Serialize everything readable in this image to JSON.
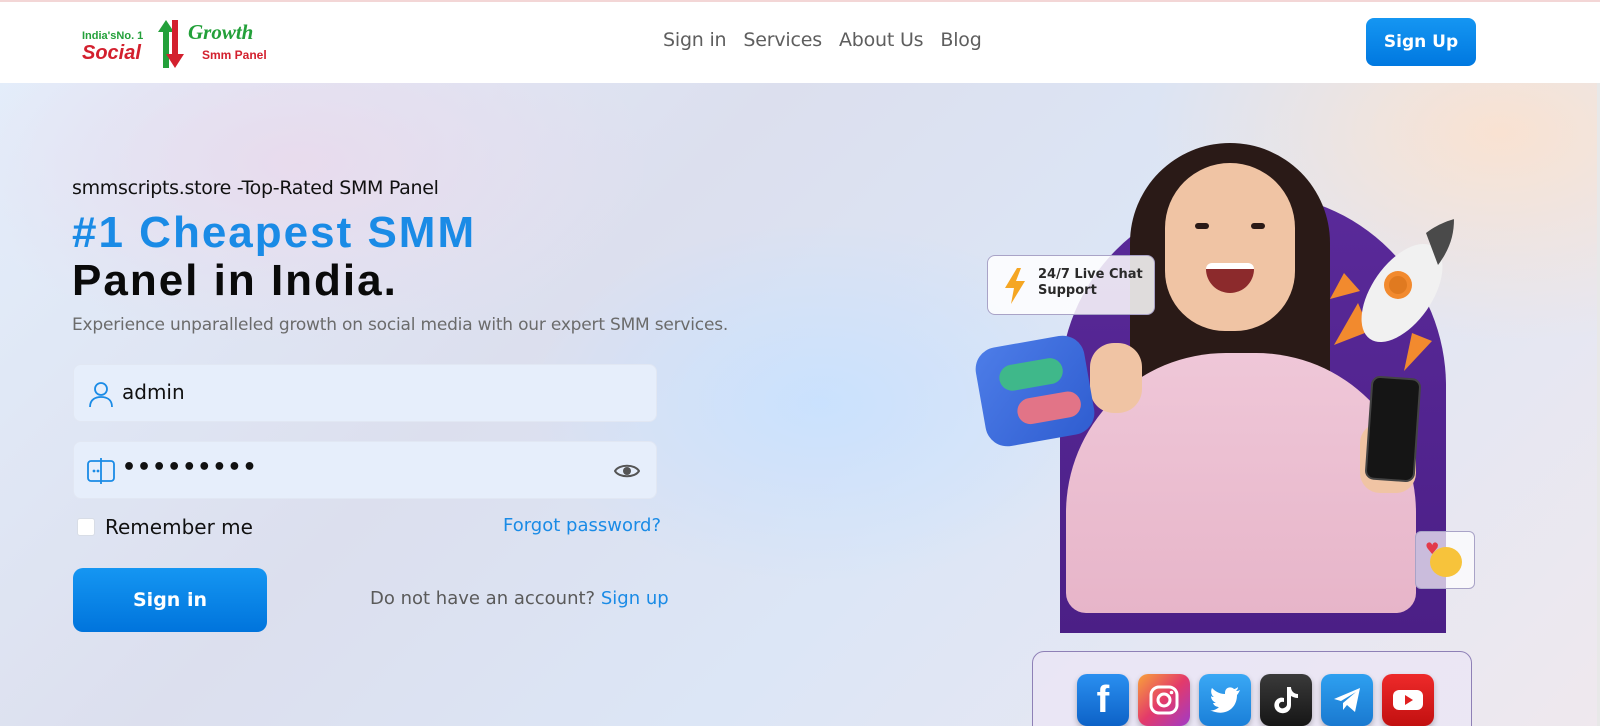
{
  "brand": {
    "tagline_small": "India'sNo. 1",
    "word_social": "Social",
    "word_growth": "Growth",
    "word_panel": "Smm Panel",
    "colors": {
      "green": "#23a03a",
      "red": "#d3202e"
    }
  },
  "nav": {
    "items": [
      "Sign in",
      "Services",
      "About Us",
      "Blog"
    ],
    "signup_label": "Sign Up"
  },
  "hero": {
    "tagline": "smmscripts.store -Top-Rated SMM Panel",
    "headline_line1": "#1 Cheapest SMM",
    "headline_line2": "Panel in India.",
    "subtext": "Experience unparalleled growth on social media with our expert SMM services."
  },
  "form": {
    "username_value": "admin",
    "password_value": "•••••••••",
    "remember_label": "Remember me",
    "forgot_label": "Forgot password?",
    "signin_label": "Sign in",
    "no_account_text": "Do not have an account?",
    "signup_link": "Sign up"
  },
  "illustration": {
    "chat_badge": "24/7 Live Chat Support",
    "social_icons": [
      "facebook-icon",
      "instagram-icon",
      "twitter-icon",
      "tiktok-icon",
      "telegram-icon",
      "youtube-icon"
    ]
  },
  "theme": {
    "accent": "#1a8be6",
    "arch": "#4b1f86"
  }
}
